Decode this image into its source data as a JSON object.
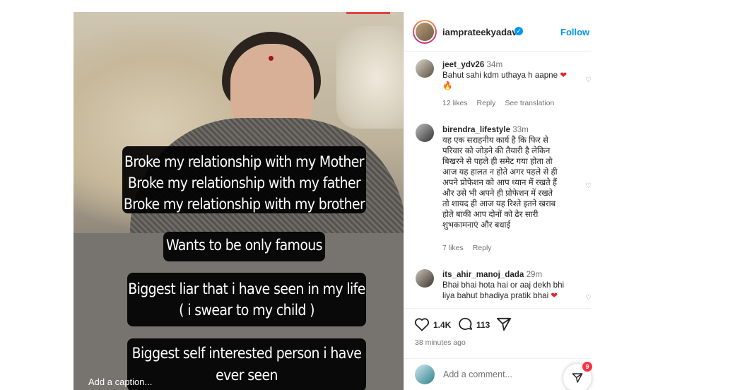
{
  "post": {
    "captions": {
      "block1": [
        "Broke my relationship with my Mother",
        "Broke my relationship with my father",
        "Broke my relationship with my brother"
      ],
      "block2": "Wants to be only famous",
      "block3": [
        "Biggest liar that i have seen in my life",
        "( i swear to my child )"
      ],
      "block4": [
        "Biggest self interested person i have",
        "ever seen"
      ]
    },
    "add_caption": "Add a caption..."
  },
  "header": {
    "username": "iamprateekyadav",
    "verified_icon": "verified-badge-icon",
    "follow_label": "Follow"
  },
  "comments": [
    {
      "username": "jeet_ydv26",
      "time": "34m",
      "text": "Bahut sahi kdm uthaya h aapne",
      "emoji_heart": "❤",
      "emoji_fire": "🔥",
      "likes": "12 likes",
      "reply": "Reply",
      "see_translation": "See translation"
    },
    {
      "username": "birendra_lifestyle",
      "time": "33m",
      "lines": [
        "यह एक सराहनीय कार्य है कि फिर से",
        "परिवार को जोड़ने की तैयारी है लेकिन",
        "बिखरने से पहले ही समेट गया होता तो",
        "आज यह हालत न होते अगर पहले से ही",
        "अपने प्रोफेशन को आप ध्यान में रखते हैं",
        "और उसे भी अपने ही प्रोफेशन में रखते",
        "तो शायद ही आज यह रिश्ते इतने खराब",
        "होते बाकी आप दोनों को ढेर सारी",
        "शुभकामनाएं और बधाई"
      ],
      "likes": "7 likes",
      "reply": "Reply"
    },
    {
      "username": "its_ahir_manoj_dada",
      "time": "29m",
      "lines": [
        "Bhai bhai hota hai or aaj dekh bhi",
        "liya bahut bhadiya pratik bhai"
      ],
      "emoji_heart": "❤"
    }
  ],
  "actions": {
    "likes_count": "1.4K",
    "comments_count": "113",
    "time_ago": "38 minutes ago"
  },
  "add_comment": {
    "placeholder": "Add a comment...",
    "badge": "9"
  }
}
